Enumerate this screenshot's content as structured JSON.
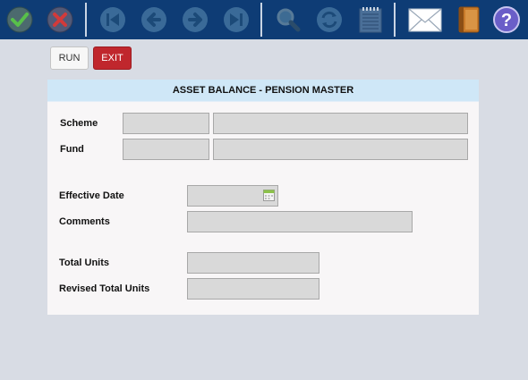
{
  "toolbar": {
    "icons": [
      "check-icon",
      "cancel-icon",
      "first-record-icon",
      "previous-icon",
      "next-icon",
      "last-record-icon",
      "search-icon",
      "refresh-icon",
      "notepad-icon",
      "mail-icon",
      "book-icon",
      "help-icon"
    ]
  },
  "actions": {
    "run_label": "RUN",
    "exit_label": "EXIT"
  },
  "form": {
    "title": "ASSET BALANCE - PENSION MASTER",
    "scheme_label": "Scheme",
    "fund_label": "Fund",
    "effective_date_label": "Effective Date",
    "comments_label": "Comments",
    "total_units_label": "Total Units",
    "revised_total_units_label": "Revised Total Units",
    "scheme_code": "",
    "scheme_name": "",
    "fund_code": "",
    "fund_name": "",
    "effective_date": "",
    "comments": "",
    "total_units": "",
    "revised_total_units": ""
  },
  "colors": {
    "toolbar_bg": "#0e3c75",
    "header_bg": "#cfe7f7",
    "exit_button": "#c0272d",
    "page_bg": "#d8dce4"
  }
}
